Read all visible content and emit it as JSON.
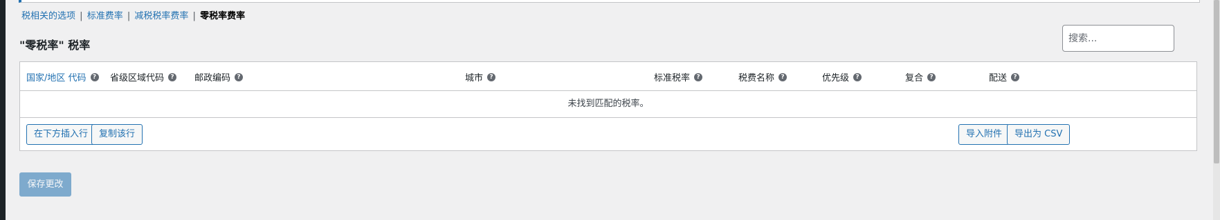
{
  "tabs": [
    {
      "label": "税相关的选项"
    },
    {
      "label": "标准费率"
    },
    {
      "label": "减税税率费率"
    },
    {
      "label": "零税率费率"
    }
  ],
  "tab_separator": "|",
  "section_title": "\"零税率\" 税率",
  "search": {
    "placeholder": "搜索..."
  },
  "table": {
    "columns": [
      {
        "label": "国家/地区 代码"
      },
      {
        "label": "省级区域代码"
      },
      {
        "label": "邮政编码"
      },
      {
        "label": "城市"
      },
      {
        "label": "标准税率"
      },
      {
        "label": "税费名称"
      },
      {
        "label": "优先级"
      },
      {
        "label": "复合"
      },
      {
        "label": "配送"
      }
    ],
    "empty_message": "未找到匹配的税率。",
    "help_symbol": "?"
  },
  "buttons": {
    "insert_row": "在下方插入行",
    "duplicate_row": "复制该行",
    "import": "导入附件",
    "export": "导出为 CSV",
    "save": "保存更改"
  },
  "colors": {
    "accent": "#2271b1",
    "background": "#f0f0f1"
  }
}
